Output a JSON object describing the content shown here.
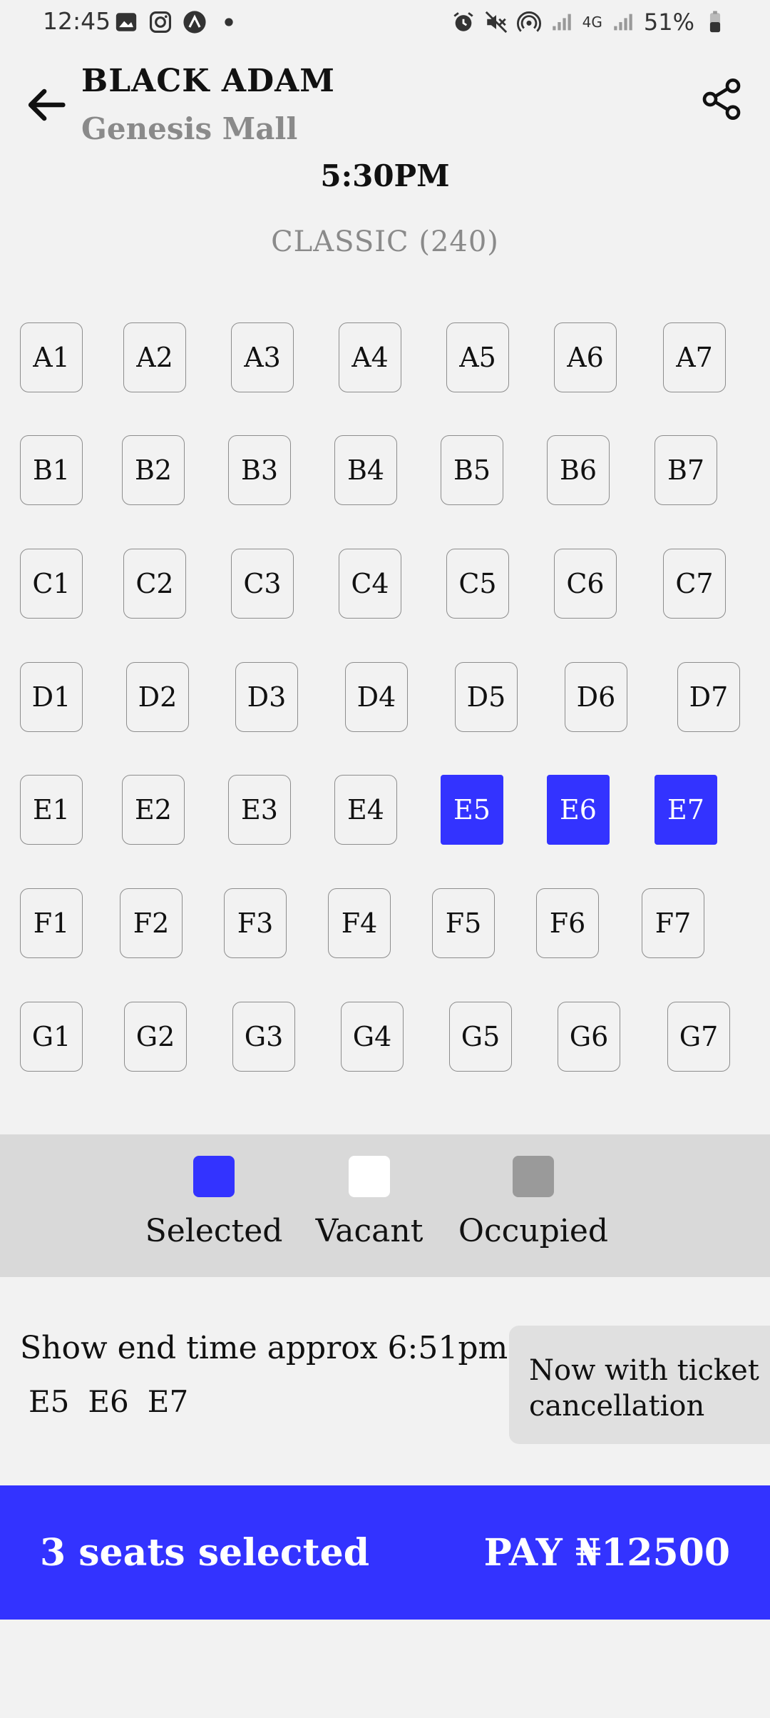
{
  "status_bar": {
    "time": "12:45",
    "battery": "51%",
    "network": "4G",
    "left_icons": [
      "gallery-icon",
      "instagram-icon",
      "app-icon",
      "dot-icon"
    ],
    "right_icons": [
      "alarm-icon",
      "mute-icon",
      "hotspot-icon",
      "signal-icon",
      "4g-icon",
      "signal-icon",
      "battery-icon"
    ]
  },
  "header": {
    "title": "BLACK ADAM",
    "subtitle": "Genesis Mall",
    "back_icon": "arrow-left-icon",
    "share_icon": "share-icon"
  },
  "showtime": "5:30PM",
  "seat_class": "CLASSIC (240)",
  "seats": [
    [
      "A1",
      "A2",
      "A3",
      "A4",
      "A5",
      "A6",
      "A7"
    ],
    [
      "B1",
      "B2",
      "B3",
      "B4",
      "B5",
      "B6",
      "B7"
    ],
    [
      "C1",
      "C2",
      "C3",
      "C4",
      "C5",
      "C6",
      "C7"
    ],
    [
      "D1",
      "D2",
      "D3",
      "D4",
      "D5",
      "D6",
      "D7"
    ],
    [
      "E1",
      "E2",
      "E3",
      "E4",
      "E5",
      "E6",
      "E7"
    ],
    [
      "F1",
      "F2",
      "F3",
      "F4",
      "F5",
      "F6",
      "F7"
    ],
    [
      "G1",
      "G2",
      "G3",
      "G4",
      "G5",
      "G6",
      "G7"
    ]
  ],
  "selected_seats": [
    "E5",
    "E6",
    "E7"
  ],
  "legend": [
    {
      "label": "Selected",
      "color": "#3333ff"
    },
    {
      "label": "Vacant",
      "color": "#ffffff"
    },
    {
      "label": "Occupied",
      "color": "#9a9a9a"
    }
  ],
  "info": {
    "end_time": "Show end time approx 6:51pm",
    "chosen": [
      "E5",
      "E6",
      "E7"
    ],
    "promo_line1": "Now with ticket",
    "promo_line2": "cancellation"
  },
  "pay_bar": {
    "count_label": "3 seats selected",
    "pay_label": "PAY ₦12500",
    "color": "#3333ff"
  }
}
